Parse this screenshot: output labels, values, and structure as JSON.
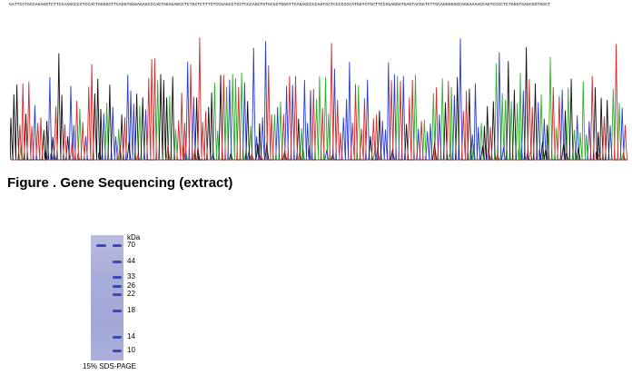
{
  "sequence": {
    "text": "GATTCCTGCCAGAGGTCTTCCAAGCCCCTCCACTGGGGCTTCAGGTGGGAGAGCCCAGTGGAGAGCCTCTGCTCTTTCTCCGAGCCTCCTCCCAGCTGTGCGCTGGGTTCAGAGCCCCAGTGCTCCCCCCCATGGTCTGCTTCCGGAGGGTGAGTACGGTCTTGCAGGGGGGCAGGAAAACCAGTCCCCTCTGGGTGAGCGGTGGCT"
  },
  "chromatogram": {
    "channel_colors": {
      "A": "#2bb02b",
      "C": "#2a3bd1",
      "G": "#111111",
      "T": "#d42a2a"
    }
  },
  "caption": {
    "text": "Figure . Gene Sequencing (extract)"
  },
  "gel": {
    "unit_label": "kDa",
    "caption": "15% SDS-PAGE",
    "ladder": [
      {
        "kda": "70"
      },
      {
        "kda": "44"
      },
      {
        "kda": "33"
      },
      {
        "kda": "26"
      },
      {
        "kda": "22"
      },
      {
        "kda": "18"
      },
      {
        "kda": "14"
      },
      {
        "kda": "10"
      }
    ],
    "band_color": "#3e48b4",
    "lane_color": "#a9aed9"
  }
}
